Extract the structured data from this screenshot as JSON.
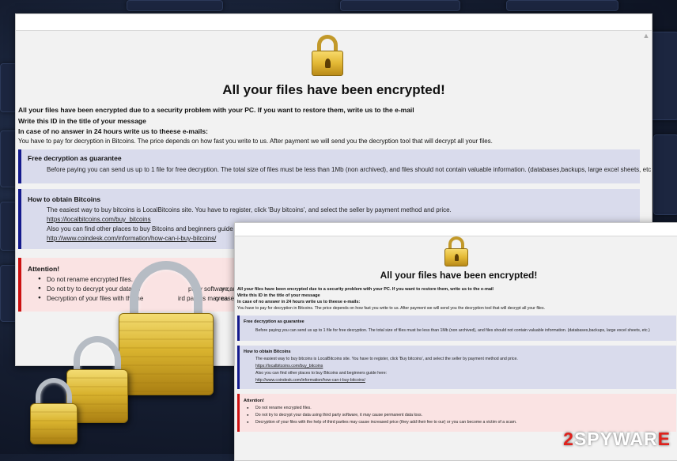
{
  "window": {
    "title": "All your files have been encrypted!",
    "intro": [
      "All your files have been encrypted due to a security problem with your PC. If you want to restore them, write us to the e-mail",
      "Write this ID in the title of your message",
      "In case of no answer in 24 hours write us to theese e-mails:"
    ],
    "payment_note": "You have to pay for decryption in Bitcoins. The price depends on how fast you write to us. After payment we will send you the decryption tool that will decrypt all your files.",
    "guarantee": {
      "heading": "Free decryption as guarantee",
      "text": "Before paying you can send us up to 1 file for free decryption. The total size of files must be less than 1Mb (non archived), and files should not contain valuable information. (databases,backups, large excel sheets, etc.)"
    },
    "bitcoins": {
      "heading": "How to obtain Bitcoins",
      "line1": "The easiest way to buy bitcoins is LocalBitcoins site. You have to register, click 'Buy bitcoins', and select the seller by payment method and price.",
      "link1": "https://localbitcoins.com/buy_bitcoins",
      "line2": "Also you can find other places to buy Bitcoins and beginners guide here:",
      "link2": "http://www.coindesk.com/information/how-can-i-buy-bitcoins/"
    },
    "attention": {
      "heading": "Attention!",
      "items": [
        "Do not rename encrypted files.",
        "Do not try to decrypt your data using third party software, it may cause permanent data loss.",
        "Decryption of your files with the help of third parties may cause increased price (they add their fee to our) or you can become a victim of a scam."
      ],
      "visible_back": [
        "Do not rename encrypted files.",
        "Do not try to decrypt your data us",
        "party software,",
        "y cause perm",
        "Decryption of your files with the he",
        "ird parties may ca",
        "creased pric"
      ]
    }
  },
  "watermark": {
    "digit": "2",
    "spy": "SPY",
    "war": "WAR",
    "end": "E"
  },
  "icons": [
    "padlock-icon",
    "padlock-icon",
    "gold-padlock-icon",
    "scroll-up-icon"
  ],
  "colors": {
    "panel_blue": "#d9dbec",
    "panel_blue_border": "#141a8c",
    "panel_red": "#fae3e3",
    "panel_red_border": "#cc1111",
    "lock_gold": "#e3b834",
    "watermark_red": "#e0211c"
  }
}
